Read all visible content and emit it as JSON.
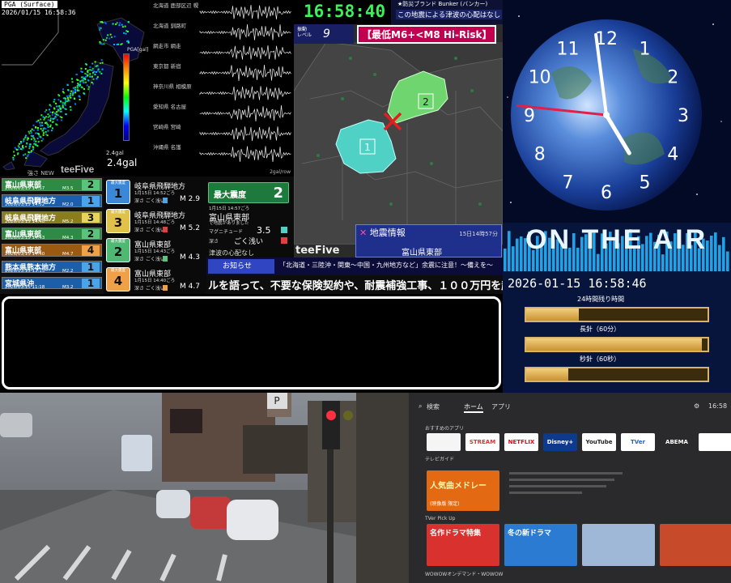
{
  "pga_map": {
    "title": "PGA (Surface)",
    "timestamp": "2026/01/15 16:58:36",
    "gal_small": "2.4gal",
    "gal_big": "2.4gal",
    "brand": "teeFive",
    "new_label": "強さ NEW",
    "scale_label": "PGA[gal]"
  },
  "seismo": {
    "stations": [
      "北海道 鹿部区辺 幌",
      "北海道 釧路町",
      "網走市 網走",
      "東京都 新宿",
      "神奈川県 相模原",
      "愛知県 名古屋",
      "宮崎県 宮崎",
      "沖縄県 名護"
    ],
    "footer": "2gal/row"
  },
  "quake_list": [
    {
      "region": "富山県東部",
      "date": "2026/01/15 14:57",
      "mag": "M3.5",
      "intensity": "2",
      "bg": "#2f8a44",
      "int_bg": "#5ac47c"
    },
    {
      "region": "岐阜県飛騨地方",
      "date": "2026/01/15 14:52",
      "mag": "M2.0",
      "intensity": "1",
      "bg": "#1c5fa8",
      "int_bg": "#4ba3e8"
    },
    {
      "region": "岐阜県飛騨地方",
      "date": "2026/01/15 14:48",
      "mag": "M5.2",
      "intensity": "3",
      "bg": "#8b7d1c",
      "int_bg": "#e7d45a"
    },
    {
      "region": "富山県東部",
      "date": "2026/01/15 14:43",
      "mag": "M4.3",
      "intensity": "2",
      "bg": "#2f8a44",
      "int_bg": "#5ac47c"
    },
    {
      "region": "富山県東部",
      "date": "2026/01/15 14:40",
      "mag": "M4.7",
      "intensity": "4",
      "bg": "#9a5a12",
      "int_bg": "#f0a048"
    },
    {
      "region": "熊本県熊本地方",
      "date": "2026/01/15 13:15",
      "mag": "M2.2",
      "intensity": "1",
      "bg": "#1c5fa8",
      "int_bg": "#4ba3e8"
    },
    {
      "region": "宮城県沖",
      "date": "2026/01/15 11:18",
      "mag": "M3.2",
      "intensity": "1",
      "bg": "#1c5fa8",
      "int_bg": "#4ba3e8"
    }
  ],
  "detail_list": [
    {
      "label": "最大震度",
      "num": "1",
      "region": "岐阜県飛騨地方",
      "time": "1月15日 14:52ごろ",
      "depth": "深さ ごく浅い",
      "mag": "M 2.9",
      "bg": "#3b88d8",
      "bar": "#4ba3e8"
    },
    {
      "label": "最大震度",
      "num": "3",
      "region": "岐阜県飛騨地方",
      "time": "1月15日 14:48ごろ",
      "depth": "深さ ごく浅い",
      "mag": "M 5.2",
      "bg": "#e0c24a",
      "bar": "#e04040"
    },
    {
      "label": "最大震度",
      "num": "2",
      "region": "富山県東部",
      "time": "1月15日 14:43ごろ",
      "depth": "深さ ごく浅い",
      "mag": "M 4.3",
      "bg": "#4fb872",
      "bar": "#5ac47c"
    },
    {
      "label": "最大震度",
      "num": "4",
      "region": "富山県東部",
      "time": "1月15日 14:40ごろ",
      "depth": "深さ ごく浅い",
      "mag": "M 4.7",
      "bg": "#f0a048",
      "bar": "#f0a048"
    }
  ],
  "info": {
    "max_label": "最大震度",
    "max_value": "2",
    "region": "富山県東部",
    "time": "1月15日 14:57ごろ",
    "time_sub": "で地震がありました",
    "mag_label": "マグニチュード",
    "mag_value": "3.5",
    "depth_label": "深さ",
    "depth_value": "ごく浅い",
    "tsunami": "津波の心配なし"
  },
  "area_map": {
    "clock": "16:58:40",
    "bunker_title": "★防災ブランド Bunker (バンカー)",
    "bunker_msg": "この地震による津波の心配はなし",
    "level_label": "振動\nレベル",
    "level_value": "9",
    "risk": "【最低M6+<M8 Hi-Risk】",
    "brand": "teeFive",
    "quake_title": "地震情報",
    "quake_date": "15日14時57分",
    "quake_region": "富山県東部",
    "area1": "1",
    "area2": "2"
  },
  "notice": {
    "tag": "お知らせ",
    "msg": "「北海道・三陸沖・関東〜中国・九州地方など」余震に注意！〜備えを〜",
    "ticker": "ルを語って、不要な保険契約や、耐震補強工事、１００万円を超える霊"
  },
  "clock": {
    "numbers": [
      "12",
      "1",
      "2",
      "3",
      "4",
      "5",
      "6",
      "7",
      "8",
      "9",
      "10",
      "11"
    ],
    "hour": 16,
    "minute": 58,
    "second": 46
  },
  "onair": {
    "title": "ON THE AIR",
    "datetime": "2026-01-15 16:58:46",
    "bars": [
      {
        "label": "24時間残り時間",
        "fill": 0.29
      },
      {
        "label": "長針（60分）",
        "fill": 0.97
      },
      {
        "label": "秒針（60秒）",
        "fill": 0.23
      }
    ],
    "bar_labels": [
      "長針（60分）",
      "秒針（60秒）"
    ]
  },
  "tv": {
    "search": "検索",
    "home": "ホーム",
    "apps": "アプリ",
    "time": "16:58",
    "recommended": "おすすめのアプリ",
    "tvguide": "テレビガイド",
    "tiles": [
      {
        "label": "",
        "bg": "#f5f5f5",
        "color": "#d33"
      },
      {
        "label": "STREAM",
        "bg": "#ffffff",
        "color": "#d33"
      },
      {
        "label": "NETFLIX",
        "bg": "#ffffff",
        "color": "#e50914"
      },
      {
        "label": "Disney+",
        "bg": "#0d3a8a",
        "color": "#fff"
      },
      {
        "label": "YouTube",
        "bg": "#ffffff",
        "color": "#222"
      },
      {
        "label": "TVer",
        "bg": "#ffffff",
        "color": "#1b66c7"
      },
      {
        "label": "ABEMA",
        "bg": "#2a2a2c",
        "color": "#fff"
      },
      {
        "label": "",
        "bg": "#ffffff",
        "color": "#2a2"
      }
    ],
    "featured_title": "人気曲メドレー",
    "featured_sub": "(映像版 限定)",
    "row_title": "TVer Pick Up",
    "cards": [
      "名作ドラマ特集",
      "冬の新ドラマ",
      "",
      ""
    ],
    "footer": "WOWOWオンデマンド・WOWOW"
  }
}
